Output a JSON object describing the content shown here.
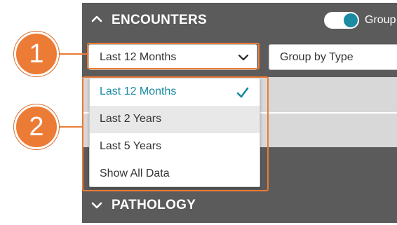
{
  "encounters": {
    "title": "ENCOUNTERS",
    "toggle_label": "Group",
    "toggle_on": true,
    "expanded": true
  },
  "filters": {
    "range_value": "Last 12 Months",
    "group_value": "Group by Type"
  },
  "range_options": [
    {
      "label": "Last 12 Months",
      "selected": true
    },
    {
      "label": "Last 2 Years",
      "hovered": true
    },
    {
      "label": "Last 5 Years"
    },
    {
      "label": "Show All Data"
    }
  ],
  "pathology": {
    "title": "PATHOLOGY",
    "expanded": false
  },
  "callouts": {
    "one": "1",
    "two": "2"
  },
  "colors": {
    "header_bg": "#5b5b5b",
    "accent_teal": "#1b8aa3",
    "callout_orange": "#ec7b36",
    "row_gray": "#d8d8d8",
    "hover_gray": "#e8e8e8"
  },
  "icons": {
    "encounters_chevron": "chevron-up-icon",
    "range_chevron": "chevron-down-icon",
    "selected_check": "check-icon",
    "pathology_chevron": "chevron-down-icon"
  }
}
